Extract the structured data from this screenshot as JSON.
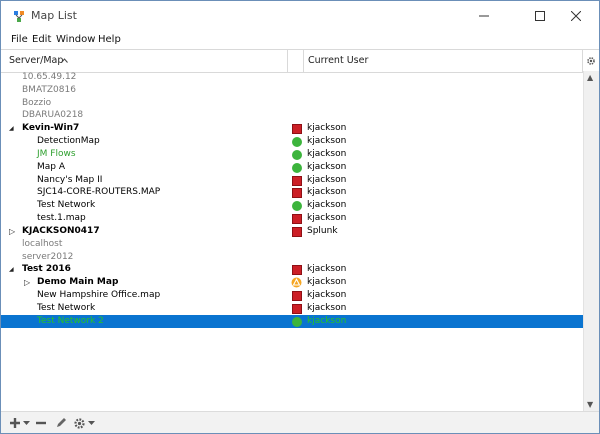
{
  "window": {
    "title": "Map List"
  },
  "menubar": {
    "items": [
      {
        "label": "File"
      },
      {
        "label": "Edit"
      },
      {
        "label": "Window"
      },
      {
        "label": "Help"
      }
    ]
  },
  "header": {
    "col1": "Server/Map",
    "col2": "Current User"
  },
  "rows": [
    {
      "name": "10.65.49.12",
      "user": "",
      "status": "",
      "style": "gray",
      "indent": 0,
      "arrow": ""
    },
    {
      "name": "BMATZ0816",
      "user": "",
      "status": "",
      "style": "gray",
      "indent": 0,
      "arrow": ""
    },
    {
      "name": "Bozzio",
      "user": "",
      "status": "",
      "style": "gray",
      "indent": 0,
      "arrow": ""
    },
    {
      "name": "DBARUA0218",
      "user": "",
      "status": "",
      "style": "gray",
      "indent": 0,
      "arrow": ""
    },
    {
      "name": "Kevin-Win7",
      "user": "kjackson",
      "status": "red",
      "style": "bold",
      "indent": 0,
      "arrow": "expanded"
    },
    {
      "name": "DetectionMap",
      "user": "kjackson",
      "status": "green",
      "style": "",
      "indent": 1,
      "arrow": ""
    },
    {
      "name": "JM Flows",
      "user": "kjackson",
      "status": "green",
      "style": "green",
      "indent": 1,
      "arrow": ""
    },
    {
      "name": "Map A",
      "user": "kjackson",
      "status": "green",
      "style": "",
      "indent": 1,
      "arrow": ""
    },
    {
      "name": "Nancy's Map II",
      "user": "kjackson",
      "status": "red",
      "style": "",
      "indent": 1,
      "arrow": ""
    },
    {
      "name": "SJC14-CORE-ROUTERS.MAP",
      "user": "kjackson",
      "status": "red",
      "style": "",
      "indent": 1,
      "arrow": ""
    },
    {
      "name": "Test Network",
      "user": "kjackson",
      "status": "green",
      "style": "",
      "indent": 1,
      "arrow": ""
    },
    {
      "name": "test.1.map",
      "user": "kjackson",
      "status": "red",
      "style": "",
      "indent": 1,
      "arrow": ""
    },
    {
      "name": "KJACKSON0417",
      "user": "Splunk",
      "status": "red",
      "style": "bold",
      "indent": 0,
      "arrow": "collapsed"
    },
    {
      "name": "localhost",
      "user": "",
      "status": "",
      "style": "gray",
      "indent": 0,
      "arrow": ""
    },
    {
      "name": "server2012",
      "user": "",
      "status": "",
      "style": "gray",
      "indent": 0,
      "arrow": ""
    },
    {
      "name": "Test 2016",
      "user": "kjackson",
      "status": "red",
      "style": "bold",
      "indent": 0,
      "arrow": "expanded"
    },
    {
      "name": "Demo Main Map",
      "user": "kjackson",
      "status": "warning",
      "style": "bold",
      "indent": 1,
      "arrow": "collapsed"
    },
    {
      "name": "New Hampshire Office.map",
      "user": "kjackson",
      "status": "red",
      "style": "",
      "indent": 1,
      "arrow": ""
    },
    {
      "name": "Test Network",
      "user": "kjackson",
      "status": "red",
      "style": "",
      "indent": 1,
      "arrow": ""
    },
    {
      "name": "Test Network 2",
      "user": "kjackson",
      "status": "green",
      "style": "green",
      "indent": 1,
      "arrow": "",
      "selected": true
    }
  ],
  "colors": {
    "selection": "#0a74d0",
    "status_red": "#cc1f26",
    "status_green": "#3cb43c",
    "status_warning": "#f5a623"
  }
}
